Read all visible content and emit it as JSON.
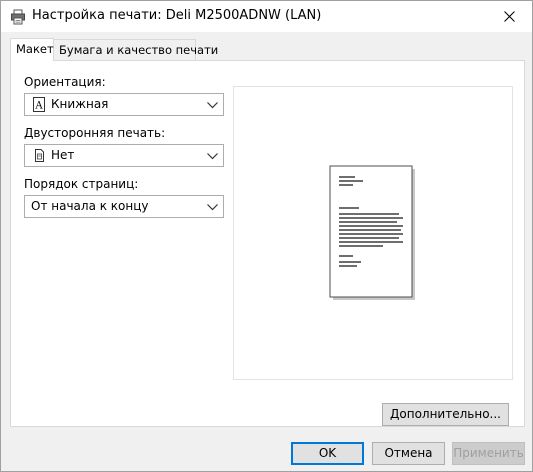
{
  "window": {
    "title": "Настройка печати: Deli M2500ADNW (LAN)"
  },
  "tabs": [
    {
      "label": "Макет"
    },
    {
      "label": "Бумага и качество печати"
    }
  ],
  "layout": {
    "orientation": {
      "label": "Ориентация:",
      "value": "Книжная",
      "icon": "portrait-page-icon"
    },
    "duplex": {
      "label": "Двусторонняя печать:",
      "value": "Нет",
      "icon": "single-sided-page-icon"
    },
    "page_order": {
      "label": "Порядок страниц:",
      "value": "От начала к концу"
    },
    "advanced_label": "Дополнительно..."
  },
  "footer": {
    "ok_label": "OK",
    "cancel_label": "Отмена",
    "apply_label": "Применить"
  },
  "colors": {
    "accent": "#0078d7",
    "panel_bg": "#ffffff",
    "window_bg": "#f0f0f0"
  }
}
